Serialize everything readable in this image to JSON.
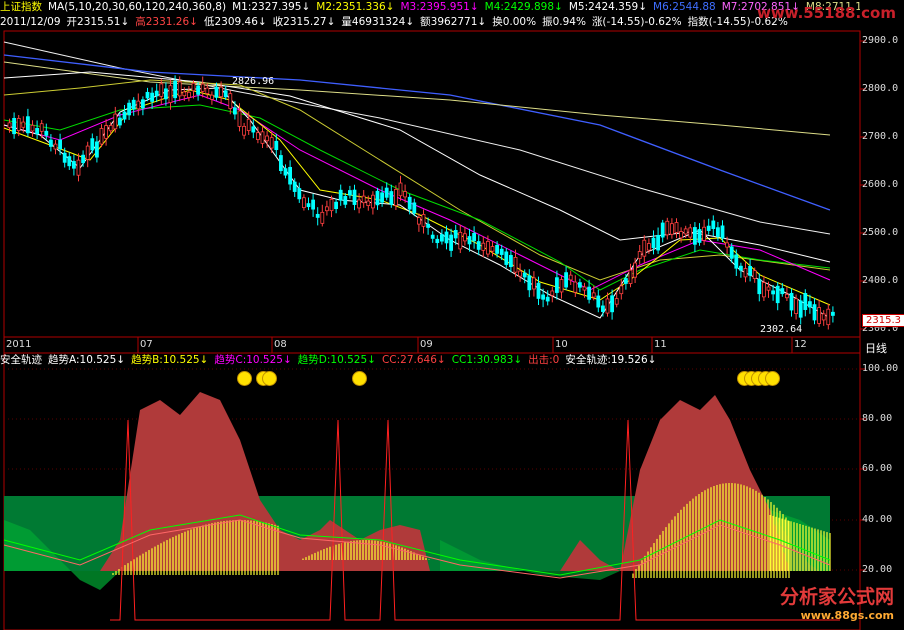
{
  "header": {
    "row1": [
      {
        "text": "上证指数",
        "color": "#ffff00"
      },
      {
        "text": "MA(5,10,20,30,60,120,240,360,8)",
        "color": "#ffffff"
      },
      {
        "text": "M1:2327.395↓",
        "color": "#ffffff"
      },
      {
        "text": "M2:2351.336↓",
        "color": "#ffff00"
      },
      {
        "text": "M3:2395.951↓",
        "color": "#ff00ff"
      },
      {
        "text": "M4:2429.898↓",
        "color": "#00ff00"
      },
      {
        "text": "M5:2424.359↓",
        "color": "#ffffff"
      },
      {
        "text": "M6:2544.88",
        "color": "#3f6fff"
      },
      {
        "text": "M7:2702.851↓",
        "color": "#ff66ff"
      },
      {
        "text": "M8:2711.181",
        "color": "#dddd88"
      }
    ],
    "row2": [
      {
        "text": "2011/12/09",
        "color": "#ffffff"
      },
      {
        "text": "开2315.51↓",
        "color": "#ffffff"
      },
      {
        "text": "高2331.26↓",
        "color": "#ff4444"
      },
      {
        "text": "低2309.46↓",
        "color": "#ffffff"
      },
      {
        "text": "收2315.27↓",
        "color": "#ffffff"
      },
      {
        "text": "量46931324↓",
        "color": "#ffffff"
      },
      {
        "text": "额3962771↓",
        "color": "#ffffff"
      },
      {
        "text": "换0.00%",
        "color": "#ffffff"
      },
      {
        "text": "振0.94%",
        "color": "#ffffff"
      },
      {
        "text": "涨(-14.55)-0.62%",
        "color": "#ffffff"
      },
      {
        "text": "指数(-14.55)-0.62%",
        "color": "#ffffff"
      }
    ],
    "watermark": "www.55188.com"
  },
  "price_panel": {
    "y_ticks": [
      "2900.0",
      "2800.0",
      "2700.0",
      "2600.0",
      "2500.0",
      "2400.0",
      "2300.0"
    ],
    "x_ticks": [
      "2011",
      "07",
      "08",
      "09",
      "10",
      "11",
      "12"
    ],
    "high_label": "2826.96",
    "low_label": "2302.64",
    "last_price": "2315.3",
    "period_label": "日线"
  },
  "indicator_panel": {
    "labels": [
      {
        "text": "安全轨迹",
        "color": "#ffffff"
      },
      {
        "text": "趋势A:10.525↓",
        "color": "#ffffff"
      },
      {
        "text": "趋势B:10.525↓",
        "color": "#ffff00"
      },
      {
        "text": "趋势C:10.525↓",
        "color": "#ff00ff"
      },
      {
        "text": "趋势D:10.525↓",
        "color": "#00ff00"
      },
      {
        "text": "CC:27.646↓",
        "color": "#ff4040"
      },
      {
        "text": "CC1:30.983↓",
        "color": "#00ff00"
      },
      {
        "text": "出击:0",
        "color": "#ff4040"
      },
      {
        "text": "安全轨迹:19.526↓",
        "color": "#ffffff"
      }
    ],
    "y_ticks": [
      "100.00",
      "80.00",
      "60.00",
      "40.00",
      "20.00"
    ]
  },
  "footer_watermark": {
    "title": "分析家公式网",
    "url": "www.88gs.com"
  }
}
